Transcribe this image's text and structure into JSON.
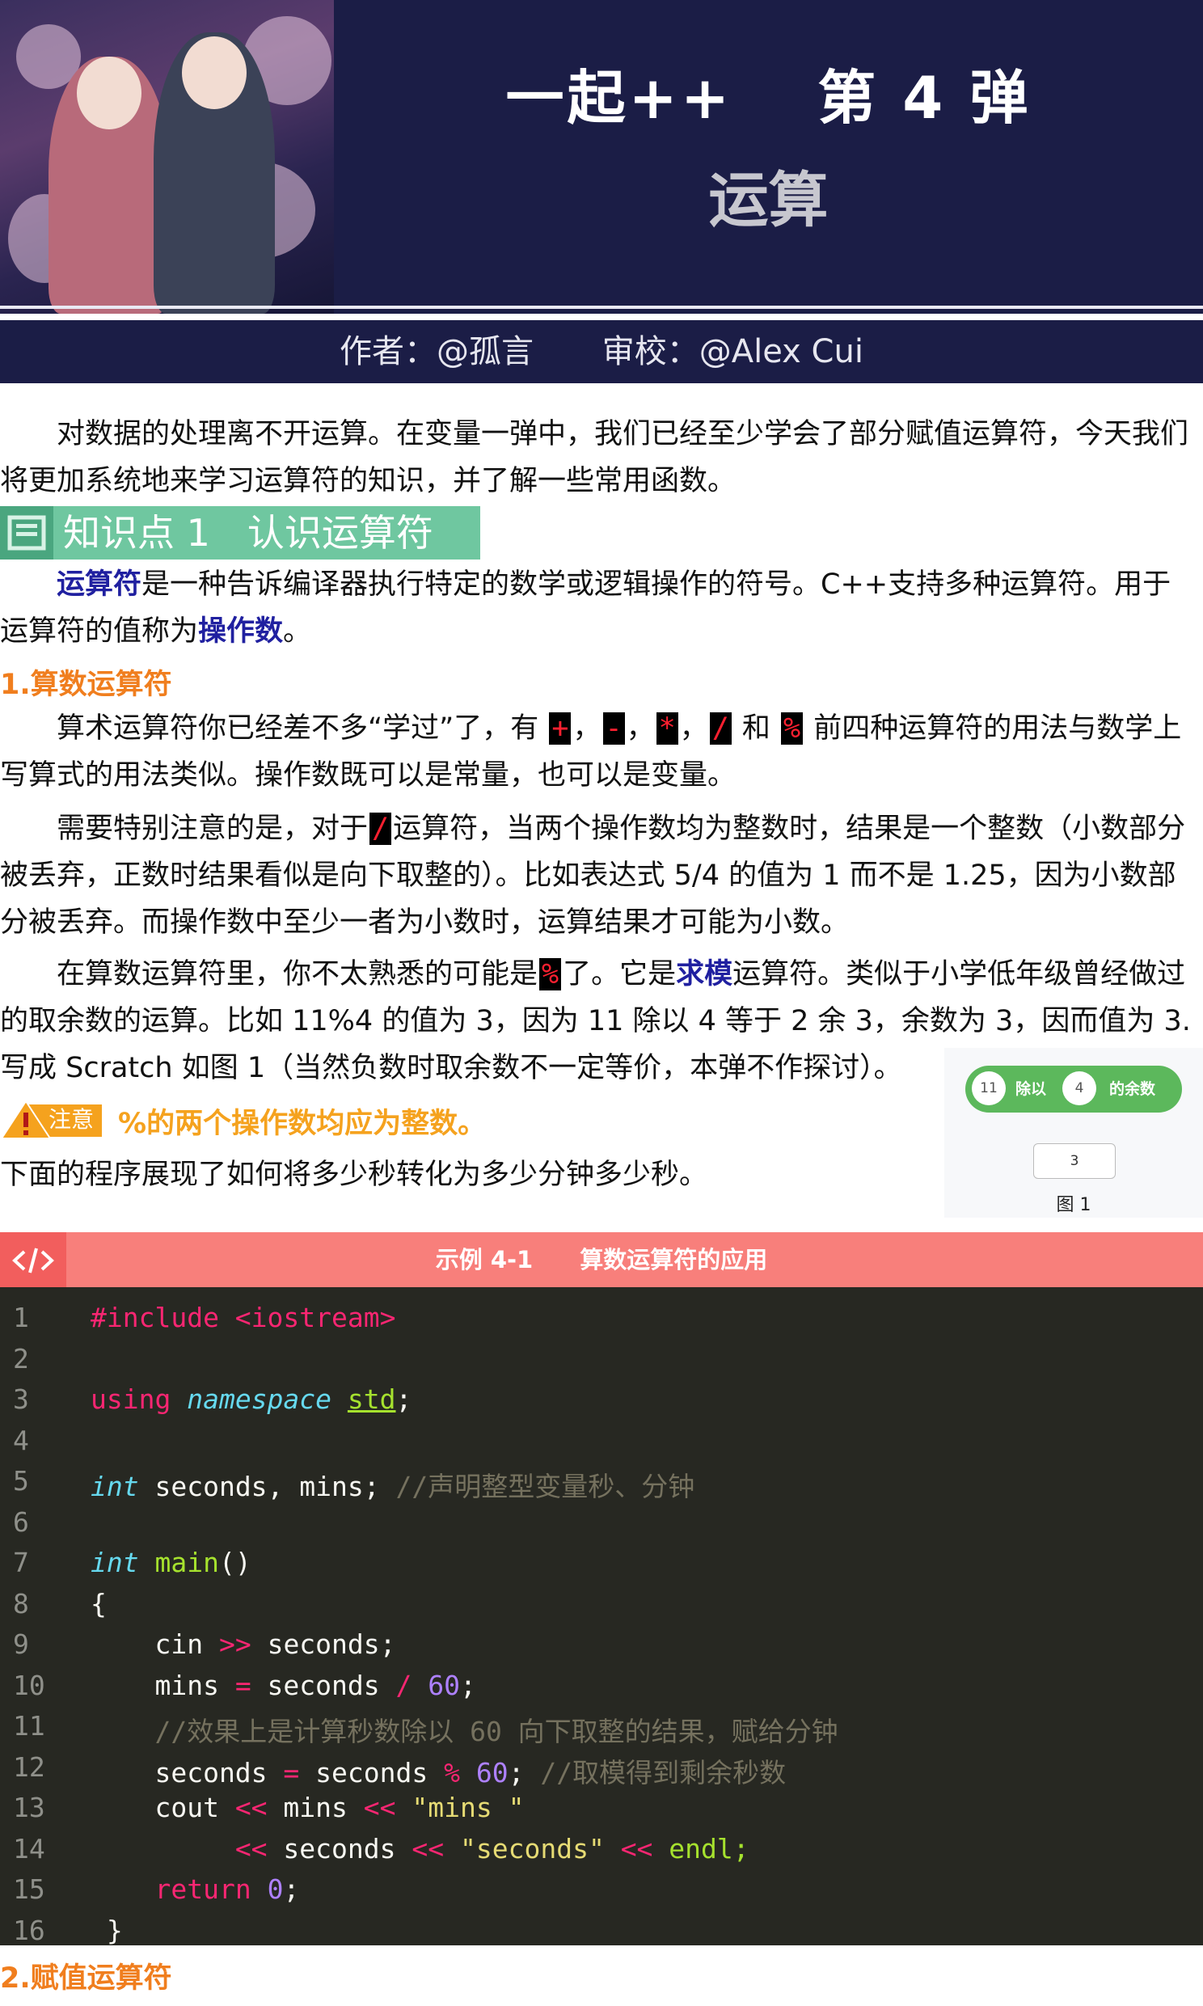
{
  "header": {
    "title": "一起++　 第 4 弹",
    "subtitle": "运算",
    "author": "作者：@孤言",
    "reviewer": "审校：@Alex Cui"
  },
  "intro": "对数据的处理离不开运算。在变量一弹中，我们已经至少学会了部分赋值运算符，今天我们将更加系统地来学习运算符的知识，并了解一些常用函数。",
  "section1": {
    "title": "知识点 1　认识运算符",
    "def_term": "运算符",
    "def_rest1": "是一种告诉编译器执行特定的数学或逻辑操作的符号。C++支持多种运算符。用于运算符的值称为",
    "def_term2": "操作数",
    "def_end": "。"
  },
  "arith": {
    "heading": "1.算数运算符",
    "p1_a": "算术运算符你已经差不多“学过”了，有 ",
    "ops": [
      "+",
      "-",
      "*",
      "/",
      "%"
    ],
    "p1_and": " 和 ",
    "p1_b": " 前四种运算符的用法与数学上写算式的用法类似。操作数既可以是常量，也可以是变量。",
    "p2_a": "需要特别注意的是，对于",
    "p2_b": "运算符，当两个操作数均为整数时，结果是一个整数（小数部分被丢弃，正数时结果看似是向下取整的）。比如表达式 5/4 的值为 1 而不是 1.25，因为小数部分被丢弃。而操作数中至少一者为小数时，运算结果才可能为小数。",
    "p3_a": "在算数运算符里，你不太熟悉的可能是",
    "p3_b": "了。它是",
    "p3_term": "求模",
    "p3_c": "运算符。类似于小学低年级曾经做过的取余数的运算。比如 11%4 的值为 3，因为 11 除以 4 等于 2 余 3，余数为 3，因而值为 3. 写成 Scratch 如图 1（当然负数时取余数不一定等价，本弹不作探讨）。",
    "note_tag": "注意",
    "note_text": "%的两个操作数均应为整数。",
    "p4": "下面的程序展现了如何将多少秒转化为多少分钟多少秒。"
  },
  "scratch": {
    "a": "11",
    "op": "除以",
    "b": "4",
    "suffix": "的余数",
    "result": "3",
    "caption": "图 1"
  },
  "example": {
    "title": "示例 4-1　　算数运算符的应用",
    "icon": "code-icon",
    "line_numbers": [
      "1",
      "2",
      "3",
      "4",
      "5",
      "6",
      "7",
      "8",
      "9",
      "10",
      "11",
      "12",
      "13",
      "14",
      "15",
      "16"
    ]
  },
  "code_text": {
    "include": "#include <iostream>",
    "using": "using",
    "namespace": "namespace",
    "std": "std",
    "semi": ";",
    "int": "int",
    "decl": " seconds, mins; ",
    "decl_comment": "//声明整型变量秒、分钟",
    "main": "main",
    "parens": "()",
    "lbrace": "{",
    "cin": "    cin ",
    "shr": ">>",
    "cin_rest": " seconds;",
    "mins_a": "    mins ",
    "eq": "=",
    "mins_b": " seconds ",
    "div": "/",
    "sixty": "60",
    "c11": "    //效果上是计算秒数除以 60 向下取整的结果，赋给分钟",
    "sec_a": "    seconds ",
    "sec_b": " seconds ",
    "mod": "%",
    "c12": " //取模得到剩余秒数",
    "cout": "    cout ",
    "shl": "<<",
    "mins_word": " mins ",
    "str_mins": "\"mins \"",
    "indent14": "         ",
    "seconds_word": " seconds ",
    "str_seconds": "\"seconds\"",
    "endl": " endl;",
    "ret_indent": "    ",
    "ret": "return",
    "zero": "0",
    "rbrace": " }"
  },
  "assign": {
    "heading": "2.赋值运算符"
  }
}
